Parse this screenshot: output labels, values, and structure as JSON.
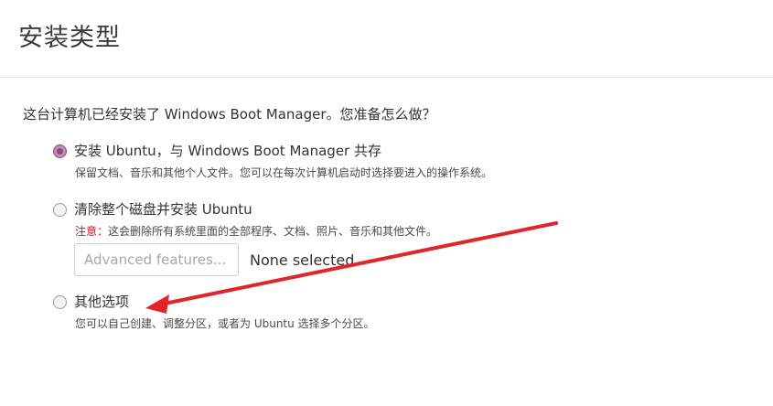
{
  "header": {
    "title": "安装类型"
  },
  "question": "这台计算机已经安装了 Windows Boot Manager。您准备怎么做？",
  "options": [
    {
      "label": "安装 Ubuntu，与 Windows Boot Manager 共存",
      "description": "保留文档、音乐和其他个人文件。您可以在每次计算机启动时选择要进入的操作系统。",
      "selected": true
    },
    {
      "label": "清除整个磁盘并安装 Ubuntu",
      "warning_prefix": "注意：",
      "description": "这会删除所有系统里面的全部程序、文档、照片、音乐和其他文件。",
      "selected": false
    },
    {
      "label": "其他选项",
      "description": "您可以自己创建、调整分区，或者为 Ubuntu 选择多个分区。",
      "selected": false
    }
  ],
  "advanced": {
    "button_label": "Advanced features...",
    "status": "None selected"
  },
  "annotation": {
    "arrow_color": "#e0262b"
  },
  "colors": {
    "radio_selected": "#8a4e7b",
    "warning": "#c7162b"
  }
}
